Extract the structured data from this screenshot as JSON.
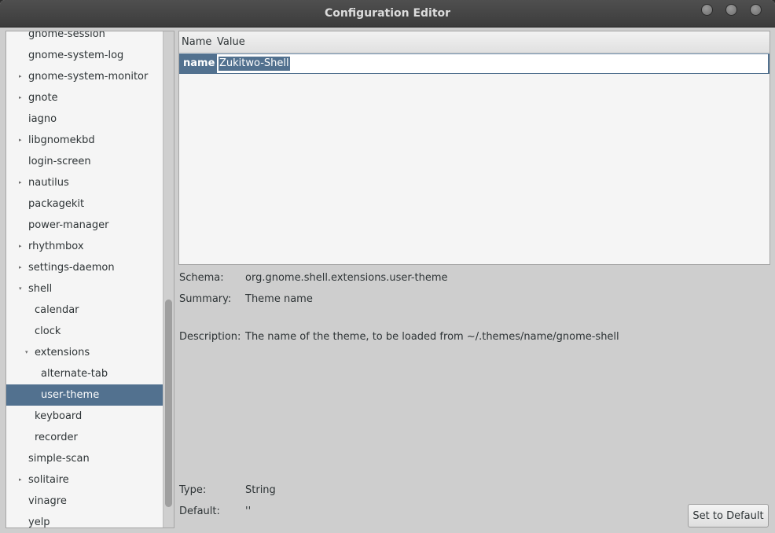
{
  "window": {
    "title": "Configuration Editor",
    "controls": [
      "minimize-icon",
      "maximize-icon",
      "close-icon"
    ]
  },
  "sidebar": {
    "items": [
      {
        "label": "gnome-session",
        "expandable": false,
        "expanded": false,
        "selected": false
      },
      {
        "label": "gnome-system-log",
        "expandable": false,
        "expanded": false,
        "selected": false
      },
      {
        "label": "gnome-system-monitor",
        "expandable": true,
        "expanded": false,
        "selected": false
      },
      {
        "label": "gnote",
        "expandable": true,
        "expanded": false,
        "selected": false
      },
      {
        "label": "iagno",
        "expandable": false,
        "expanded": false,
        "selected": false
      },
      {
        "label": "libgnomekbd",
        "expandable": true,
        "expanded": false,
        "selected": false
      },
      {
        "label": "login-screen",
        "expandable": false,
        "expanded": false,
        "selected": false
      },
      {
        "label": "nautilus",
        "expandable": true,
        "expanded": false,
        "selected": false
      },
      {
        "label": "packagekit",
        "expandable": false,
        "expanded": false,
        "selected": false
      },
      {
        "label": "power-manager",
        "expandable": false,
        "expanded": false,
        "selected": false
      },
      {
        "label": "rhythmbox",
        "expandable": true,
        "expanded": false,
        "selected": false
      },
      {
        "label": "settings-daemon",
        "expandable": true,
        "expanded": false,
        "selected": false
      },
      {
        "label": "shell",
        "expandable": true,
        "expanded": true,
        "selected": false
      },
      {
        "label": "calendar",
        "expandable": false,
        "expanded": false,
        "selected": false
      },
      {
        "label": "clock",
        "expandable": false,
        "expanded": false,
        "selected": false
      },
      {
        "label": "extensions",
        "expandable": true,
        "expanded": true,
        "selected": false
      },
      {
        "label": "alternate-tab",
        "expandable": false,
        "expanded": false,
        "selected": false
      },
      {
        "label": "user-theme",
        "expandable": false,
        "expanded": false,
        "selected": true
      },
      {
        "label": "keyboard",
        "expandable": false,
        "expanded": false,
        "selected": false
      },
      {
        "label": "recorder",
        "expandable": false,
        "expanded": false,
        "selected": false
      },
      {
        "label": "simple-scan",
        "expandable": false,
        "expanded": false,
        "selected": false
      },
      {
        "label": "solitaire",
        "expandable": true,
        "expanded": false,
        "selected": false
      },
      {
        "label": "vinagre",
        "expandable": false,
        "expanded": false,
        "selected": false
      },
      {
        "label": "yelp",
        "expandable": false,
        "expanded": false,
        "selected": false
      }
    ]
  },
  "keys_table": {
    "columns": [
      "Name",
      "Value"
    ],
    "rows": [
      {
        "name": "name",
        "value": "Zukitwo-Shell"
      }
    ]
  },
  "details": {
    "schema_label": "Schema:",
    "schema_value": "org.gnome.shell.extensions.user-theme",
    "summary_label": "Summary:",
    "summary_value": "Theme name",
    "description_label": "Description:",
    "description_value": "The name of the theme, to be loaded from ~/.themes/name/gnome-shell",
    "type_label": "Type:",
    "type_value": "String",
    "default_label": "Default:",
    "default_value": "''"
  },
  "actions": {
    "set_default_label": "Set to Default"
  },
  "colors": {
    "titlebar": "#3c3c3c",
    "selection": "#52718f",
    "background": "#cecece",
    "list_background": "#f5f5f5"
  }
}
